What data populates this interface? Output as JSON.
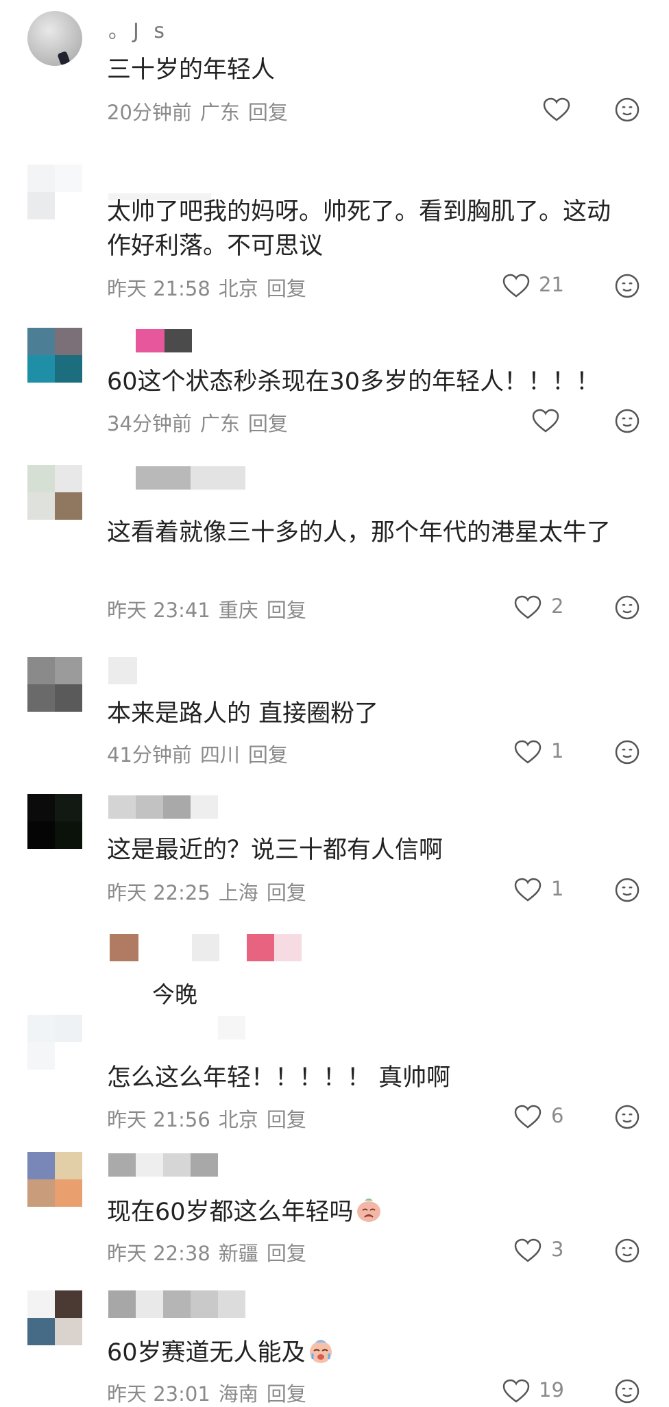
{
  "comments": [
    {
      "name": "。J s",
      "text": "三十岁的年轻人",
      "time": "20分钟前",
      "region": "广东",
      "reply": "回复",
      "likes": ""
    },
    {
      "name": "",
      "text": "太帅了吧我的妈呀。帅死了。看到胸肌了。这动作好利落。不可思议",
      "time": "昨天 21:58",
      "region": "北京",
      "reply": "回复",
      "likes": "21"
    },
    {
      "name": "",
      "text": "60这个状态秒杀现在30多岁的年轻人！！！！",
      "time": "34分钟前",
      "region": "广东",
      "reply": "回复",
      "likes": ""
    },
    {
      "name": "",
      "text": "这看着就像三十多的人，那个年代的港星太牛了",
      "time": "昨天 23:41",
      "region": "重庆",
      "reply": "回复",
      "likes": "2"
    },
    {
      "name": "",
      "text": "本来是路人的 直接圈粉了",
      "time": "41分钟前",
      "region": "四川",
      "reply": "回复",
      "likes": "1"
    },
    {
      "name": "",
      "text": "这是最近的？说三十都有人信啊",
      "time": "昨天 22:25",
      "region": "上海",
      "reply": "回复",
      "likes": "1"
    },
    {
      "name": "",
      "text": "怎么这么年轻！！！！！ 真帅啊",
      "time": "昨天 21:56",
      "region": "北京",
      "reply": "回复",
      "likes": "6"
    },
    {
      "name": "",
      "text": "现在60岁都这么年轻吗",
      "time": "昨天 22:38",
      "region": "新疆",
      "reply": "回复",
      "likes": "3"
    },
    {
      "name": "",
      "text": "60岁赛道无人能及",
      "time": "昨天 23:01",
      "region": "海南",
      "reply": "回复",
      "likes": "19"
    }
  ],
  "sub_reply": {
    "text": "今晚"
  },
  "icons": {
    "like": "heart-outline-icon",
    "react": "face-emoji-icon",
    "emoji_a": "crying-face-emoji",
    "emoji_b": "crying-face-emoji"
  },
  "colors": {
    "text": "#222222",
    "meta": "#8a8a8a",
    "icon": "#555555",
    "background": "#ffffff"
  }
}
